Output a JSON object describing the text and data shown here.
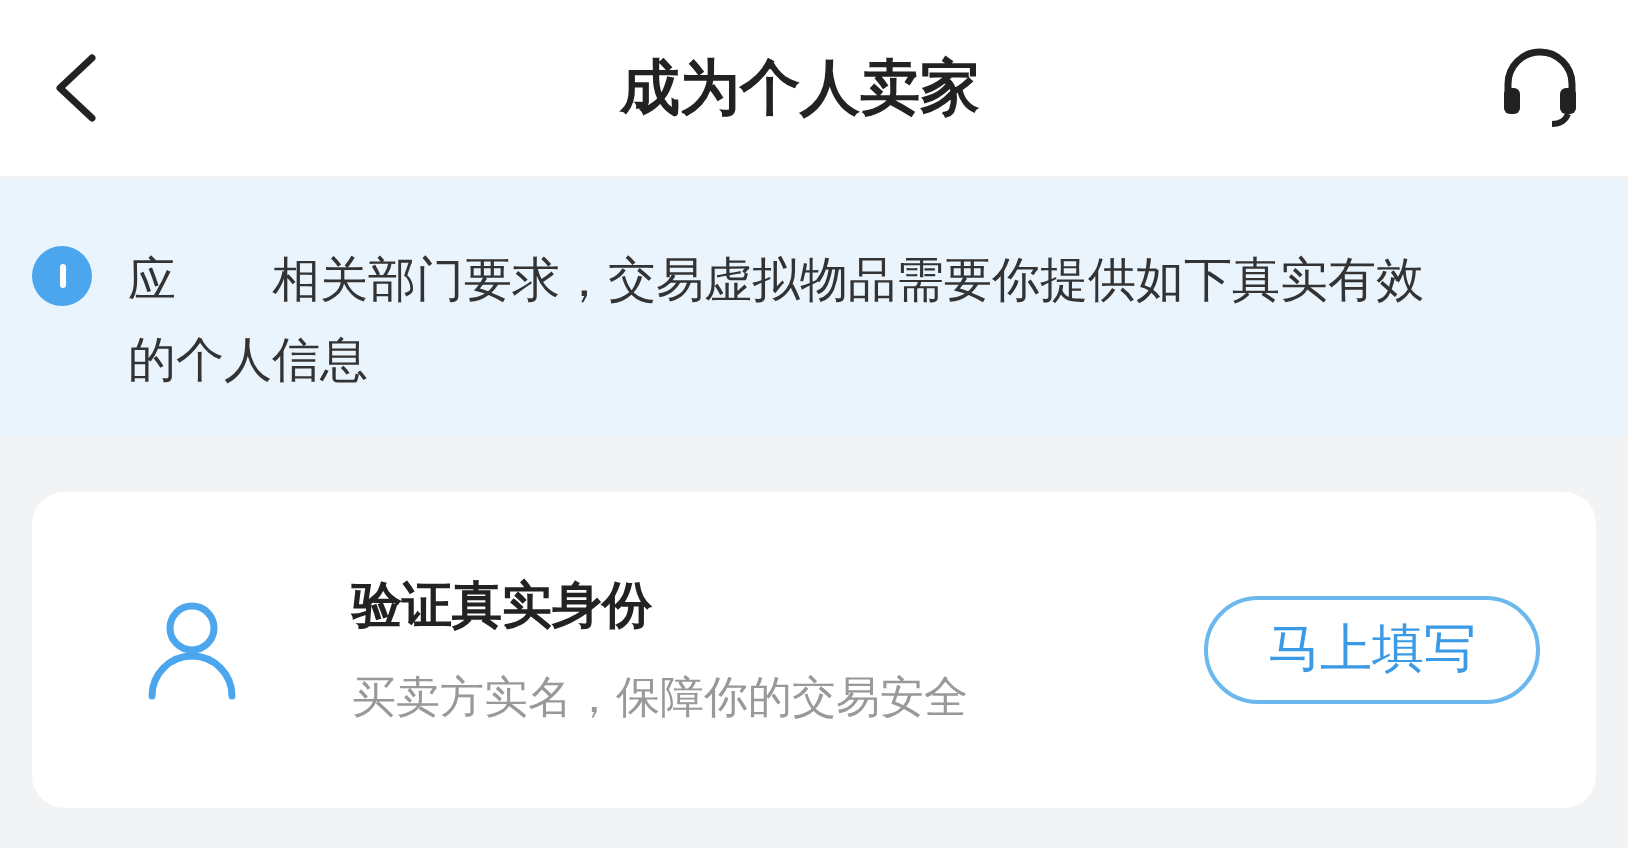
{
  "header": {
    "title": "成为个人卖家"
  },
  "notice": {
    "text": "应　　相关部门要求，交易虚拟物品需要你提供如下真实有效的个人信息"
  },
  "card": {
    "title": "验证真实身份",
    "subtitle": "买卖方实名，保障你的交易安全",
    "button": "马上填写"
  }
}
